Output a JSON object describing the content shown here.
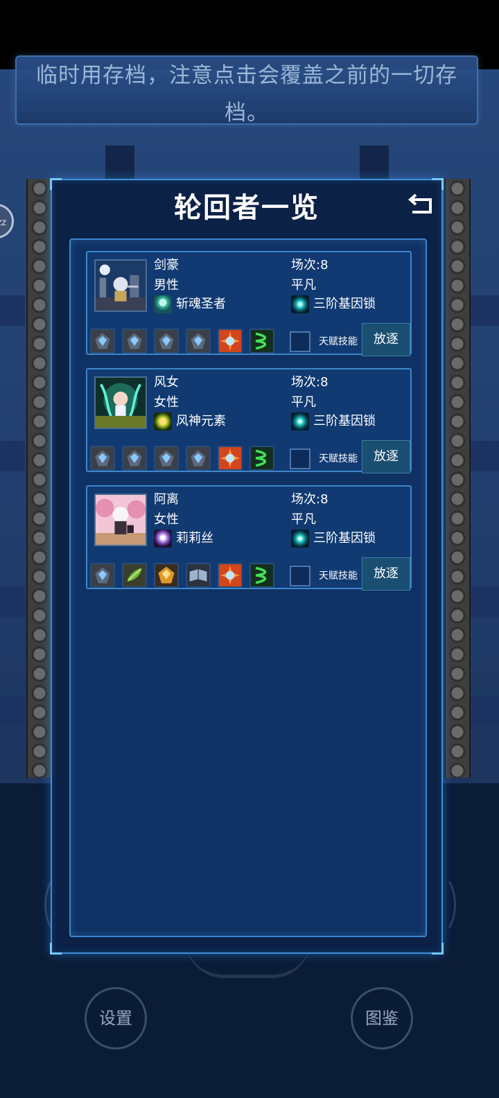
{
  "notice": {
    "text": "临时用存档，注意点击会覆盖之前的一切存档。"
  },
  "side_badge": {
    "label": "zz"
  },
  "panel": {
    "title": "轮回者一览"
  },
  "characters": [
    {
      "name": "剑豪",
      "gender": "男性",
      "skill": "斩魂圣者",
      "rounds": "场次:8",
      "rank": "平凡",
      "gene_lock": "三阶基因锁",
      "talent_label": "天赋技能",
      "exile_label": "放逐",
      "items": [
        "dark-crystal-item-icon",
        "dark-crystal-item-icon",
        "dark-crystal-item-icon",
        "dark-crystal-item-icon",
        "orb-burst-item-icon",
        "green-helix-item-icon"
      ]
    },
    {
      "name": "风女",
      "gender": "女性",
      "skill": "风神元素",
      "rounds": "场次:8",
      "rank": "平凡",
      "gene_lock": "三阶基因锁",
      "talent_label": "天赋技能",
      "exile_label": "放逐",
      "items": [
        "dark-crystal-item-icon",
        "dark-crystal-item-icon",
        "dark-crystal-item-icon",
        "dark-crystal-item-icon",
        "orb-burst-item-icon",
        "green-helix-item-icon"
      ]
    },
    {
      "name": "阿离",
      "gender": "女性",
      "skill": "莉莉丝",
      "rounds": "场次:8",
      "rank": "平凡",
      "gene_lock": "三阶基因锁",
      "talent_label": "天赋技能",
      "exile_label": "放逐",
      "items": [
        "dark-crystal-item-icon",
        "green-leaf-item-icon",
        "amber-gem-item-icon",
        "spell-book-item-icon",
        "orb-burst-item-icon",
        "green-helix-item-icon"
      ]
    }
  ],
  "bottom": {
    "settings_label": "设置",
    "atlas_label": "图鉴"
  },
  "colors": {
    "panel_border": "#3e8fd8",
    "panel_bg": "#0b2145",
    "card_bg": "#113a72",
    "accent": "#78c8ff",
    "button_bg": "#1a4f72"
  }
}
